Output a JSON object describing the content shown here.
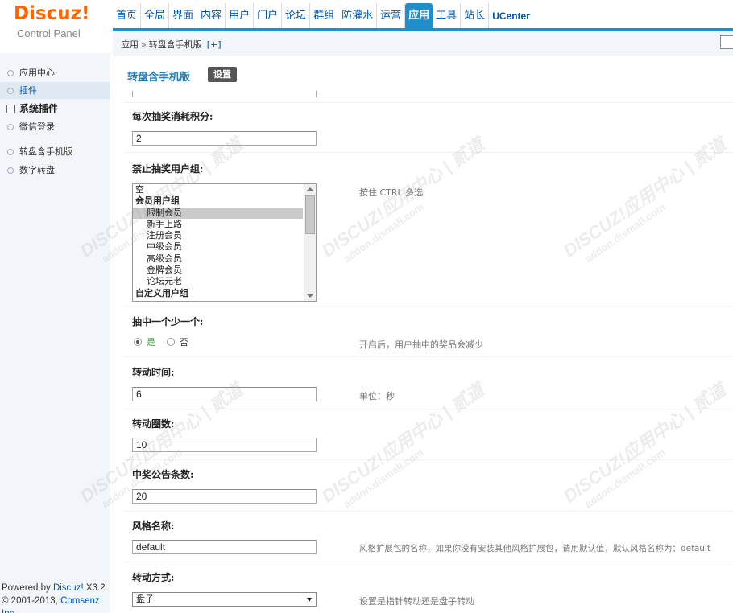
{
  "logo": {
    "brand": "Discuz!",
    "subtitle": "Control Panel"
  },
  "nav": {
    "items": [
      "首页",
      "全局",
      "界面",
      "内容",
      "用户",
      "门户",
      "论坛",
      "群组",
      "防灌水",
      "运营",
      "应用",
      "工具",
      "站长",
      "UCenter"
    ],
    "active": "应用"
  },
  "breadcrumb": {
    "root": "应用",
    "sep": "»",
    "current": "转盘含手机版",
    "add": "[+]"
  },
  "sidebar": {
    "items": [
      {
        "label": "应用中心"
      },
      {
        "label": "插件"
      },
      {
        "label": "系统插件"
      },
      {
        "label": "微信登录"
      },
      {
        "label": "转盘含手机版"
      },
      {
        "label": "数字转盘"
      }
    ],
    "footer_line1_prefix": "Powered by ",
    "footer_brand": "Discuz!",
    "footer_version": " X3.2",
    "footer_line2_prefix": "© 2001-2013, ",
    "footer_company": "Comsenz Inc."
  },
  "page": {
    "title": "转盘含手机版",
    "tab": "设置"
  },
  "form": {
    "cost": {
      "label": "每次抽奖消耗积分:",
      "value": "2"
    },
    "forbid": {
      "label": "禁止抽奖用户组:",
      "hint": "按住 CTRL 多选",
      "options": [
        "空",
        "会员用户组",
        "限制会员",
        "新手上路",
        "注册会员",
        "中级会员",
        "高级会员",
        "金牌会员",
        "论坛元老",
        "自定义用户组"
      ]
    },
    "reduce": {
      "label": "抽中一个少一个:",
      "yes": "是",
      "no": "否",
      "hint": "开启后，用户抽中的奖品会减少"
    },
    "spin_time": {
      "label": "转动时间:",
      "value": "6",
      "hint": "单位：秒"
    },
    "spin_rounds": {
      "label": "转动圈数:",
      "value": "10"
    },
    "notice_count": {
      "label": "中奖公告条数:",
      "value": "20"
    },
    "style_name": {
      "label": "风格名称:",
      "value": "default",
      "hint": "风格扩展包的名称，如果你没有安装其他风格扩展包，请用默认值，默认风格名称为：default"
    },
    "spin_mode": {
      "label": "转动方式:",
      "value": "盘子",
      "hint": "设置是指针转动还是盘子转动"
    }
  },
  "watermark": {
    "line1": "DISCUZ!应用中心 | 贰道",
    "line2": "addon.dismall.com"
  },
  "colors": {
    "accent": "#1e8fc8",
    "logo": "#ff6600",
    "link": "#0055aa"
  }
}
